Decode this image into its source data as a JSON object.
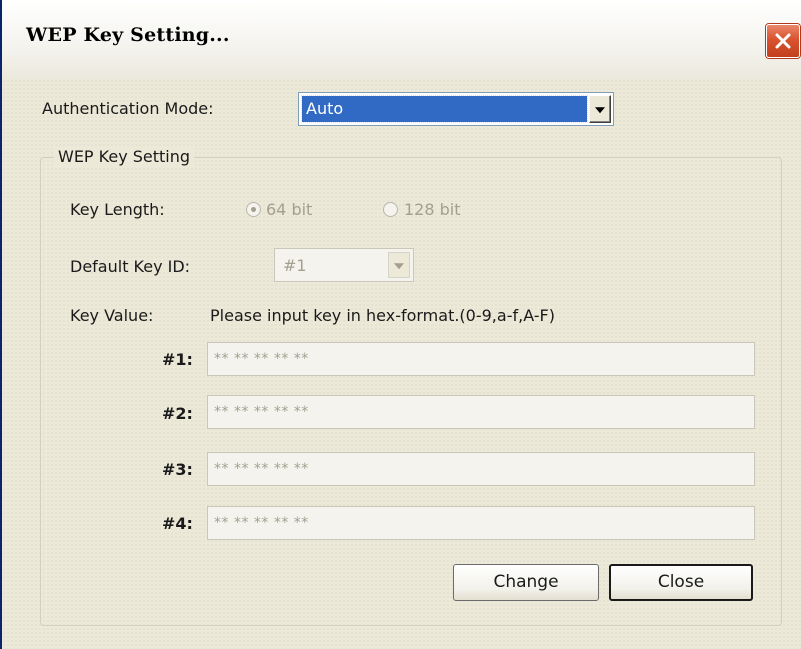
{
  "window": {
    "title": "WEP Key Setting..."
  },
  "auth": {
    "label": "Authentication Mode:",
    "value": "Auto"
  },
  "wep_group": {
    "legend": "WEP Key Setting",
    "key_length": {
      "label": "Key Length:",
      "options": [
        {
          "label": "64 bit",
          "selected": true
        },
        {
          "label": "128 bit",
          "selected": false
        }
      ]
    },
    "default_key": {
      "label": "Default Key ID:",
      "value": "#1"
    },
    "key_value": {
      "label": "Key Value:",
      "hint": "Please input key in hex-format.(0-9,a-f,A-F)"
    },
    "keys": [
      {
        "label": "#1:",
        "value": "** ** ** ** **"
      },
      {
        "label": "#2:",
        "value": "** ** ** ** **"
      },
      {
        "label": "#3:",
        "value": "** ** ** ** **"
      },
      {
        "label": "#4:",
        "value": "** ** ** ** **"
      }
    ]
  },
  "buttons": {
    "change": "Change",
    "close": "Close"
  },
  "colors": {
    "selection": "#316ac5",
    "close_button": "#d9532f",
    "disabled_text": "#a3a08f"
  }
}
